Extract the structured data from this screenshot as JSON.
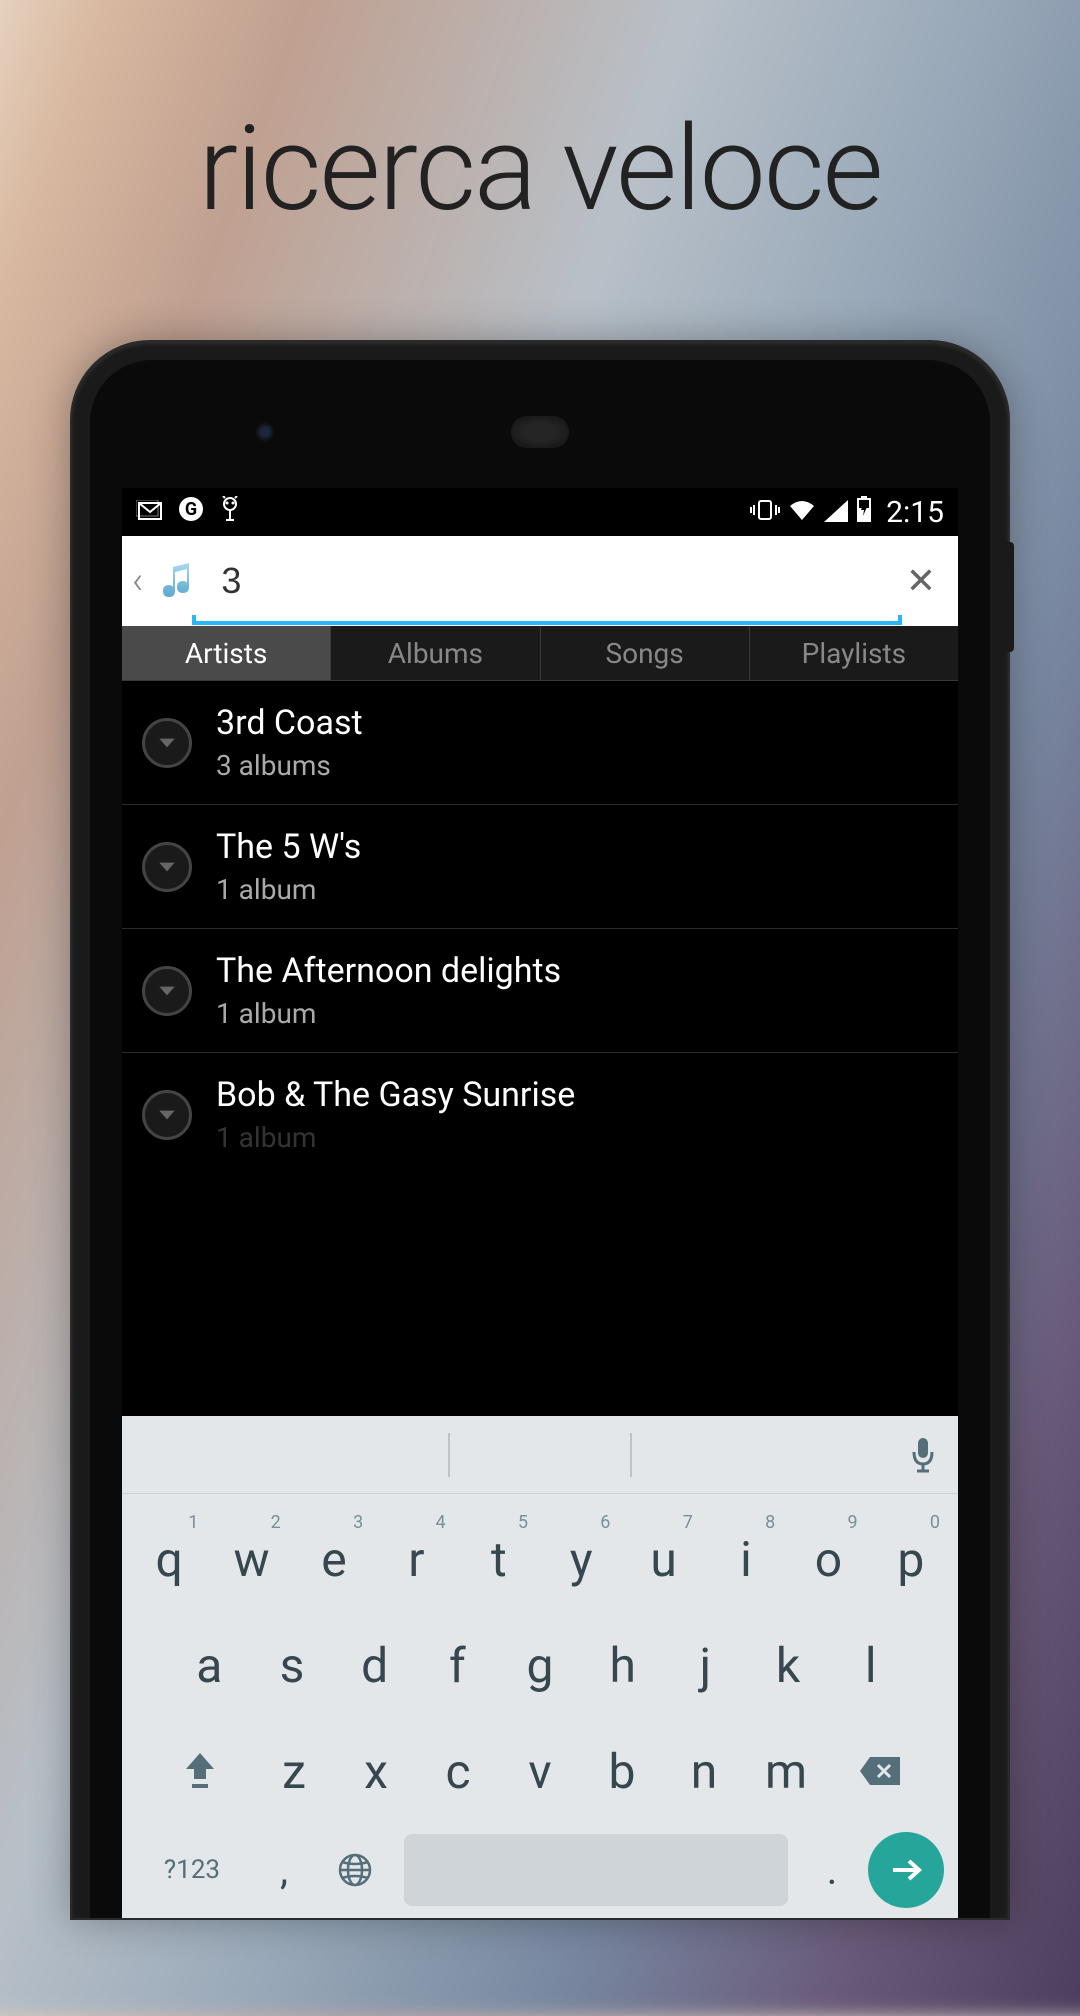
{
  "headline": "ricerca veloce",
  "status": {
    "time": "2:15"
  },
  "search": {
    "value": "3"
  },
  "tabs": [
    {
      "label": "Artists",
      "active": true
    },
    {
      "label": "Albums",
      "active": false
    },
    {
      "label": "Songs",
      "active": false
    },
    {
      "label": "Playlists",
      "active": false
    }
  ],
  "results": [
    {
      "title": "3rd Coast",
      "subtitle": "3 albums"
    },
    {
      "title": "The 5 W's",
      "subtitle": "1 album"
    },
    {
      "title": "The Afternoon delights",
      "subtitle": "1 album"
    },
    {
      "title": "Bob & The Gasy Sunrise",
      "subtitle": "1 album"
    }
  ],
  "keyboard": {
    "row1": [
      {
        "l": "q",
        "n": "1"
      },
      {
        "l": "w",
        "n": "2"
      },
      {
        "l": "e",
        "n": "3"
      },
      {
        "l": "r",
        "n": "4"
      },
      {
        "l": "t",
        "n": "5"
      },
      {
        "l": "y",
        "n": "6"
      },
      {
        "l": "u",
        "n": "7"
      },
      {
        "l": "i",
        "n": "8"
      },
      {
        "l": "o",
        "n": "9"
      },
      {
        "l": "p",
        "n": "0"
      }
    ],
    "row2": [
      "a",
      "s",
      "d",
      "f",
      "g",
      "h",
      "j",
      "k",
      "l"
    ],
    "row3": [
      "z",
      "x",
      "c",
      "v",
      "b",
      "n",
      "m"
    ],
    "sym": "?123",
    "comma": ",",
    "period": "."
  }
}
